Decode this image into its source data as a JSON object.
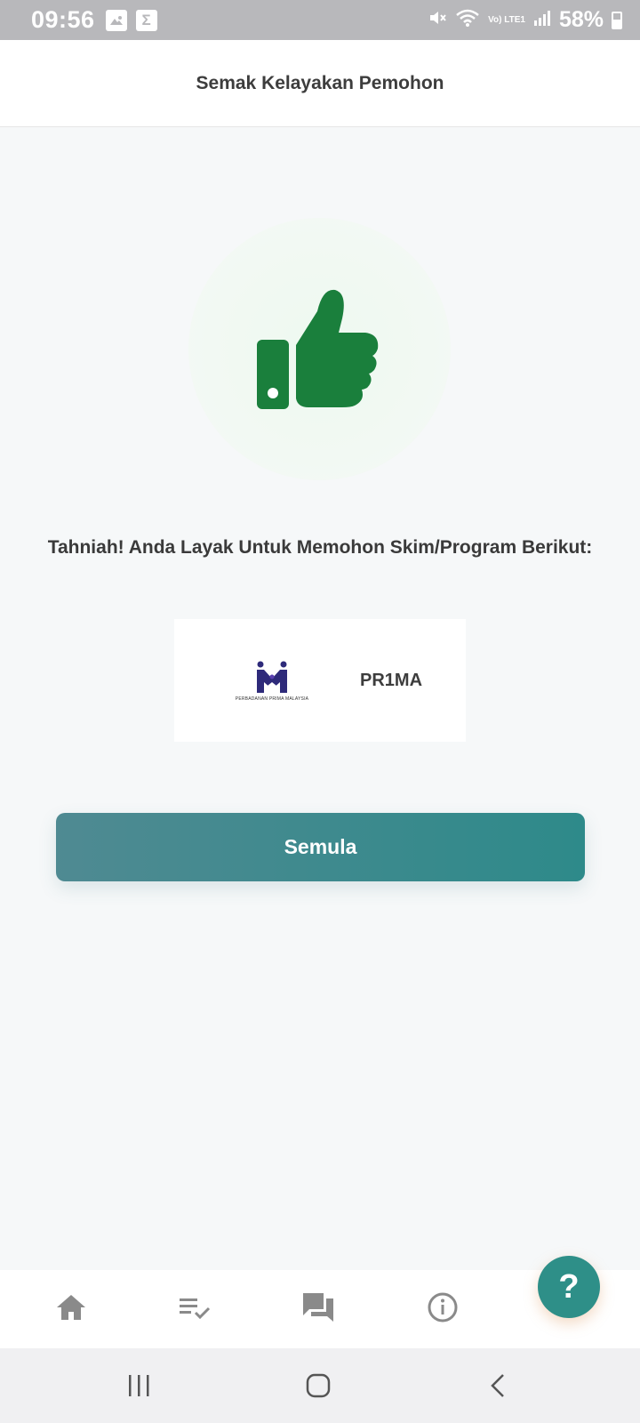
{
  "status_bar": {
    "time": "09:56",
    "left_icons": [
      "image-icon",
      "sigma-icon"
    ],
    "sigma_glyph": "Σ",
    "lte_label": "Vo) LTE1",
    "battery": "58%"
  },
  "header": {
    "title": "Semak Kelayakan Pemohon"
  },
  "result": {
    "icon": "thumbs-up-icon",
    "message": "Tahniah! Anda Layak Untuk Memohon Skim/Program Berikut:"
  },
  "programs": [
    {
      "logo_caption": "PERBADANAN PRIMA MALAYSIA",
      "name": "PR1MA"
    }
  ],
  "actions": {
    "semula_label": "Semula"
  },
  "bottom_nav": {
    "items": [
      "home-icon",
      "checklist-icon",
      "chat-icon",
      "info-icon"
    ]
  },
  "help": {
    "label": "?"
  },
  "colors": {
    "accent": "#2e8a8a",
    "thumb": "#1a7f3c",
    "nav_icon": "#8a8a8a"
  }
}
